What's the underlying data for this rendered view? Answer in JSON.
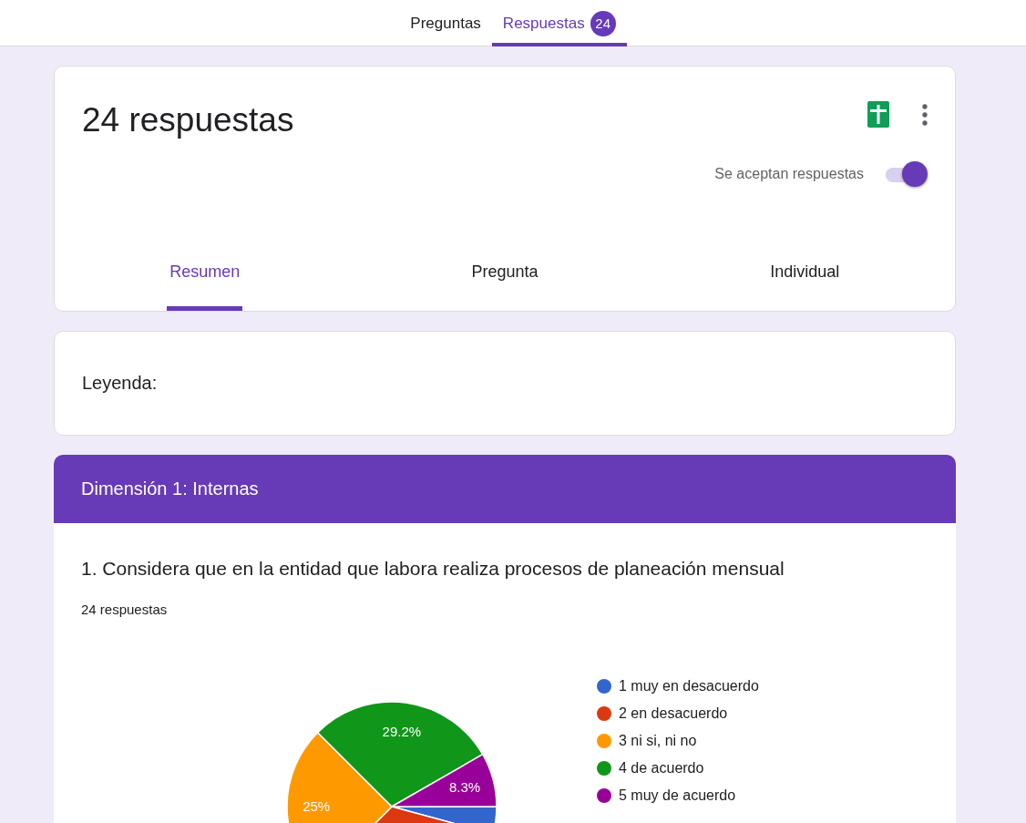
{
  "top_tabs": [
    {
      "label": "Preguntas",
      "selected": false
    },
    {
      "label": "Respuestas",
      "selected": true,
      "badge": "24"
    }
  ],
  "summary": {
    "title": "24 respuestas",
    "accepting": {
      "label": "Se aceptan respuestas",
      "on": true
    },
    "tabs": [
      {
        "label": "Resumen",
        "selected": true
      },
      {
        "label": "Pregunta",
        "selected": false
      },
      {
        "label": "Individual",
        "selected": false
      }
    ]
  },
  "legend_card": {
    "title": "Leyenda:"
  },
  "section": {
    "title": "Dimensión 1: Internas",
    "question": {
      "title": "1. Considera que en la entidad que labora realiza procesos de planeación mensual",
      "count": "24 respuestas",
      "chart_data": {
        "type": "pie",
        "categories": [
          "1 muy en desacuerdo",
          "2 en desacuerdo",
          "3 ni si, ni no",
          "4 de acuerdo",
          "5 muy de acuerdo"
        ],
        "values": [
          4.2,
          33.3,
          25,
          29.2,
          8.3
        ],
        "colors": [
          "#3366cc",
          "#dc3912",
          "#ff9900",
          "#109618",
          "#990099"
        ],
        "value_labels": [
          null,
          null,
          "25%",
          "29.2%",
          "8.3%"
        ]
      }
    }
  }
}
